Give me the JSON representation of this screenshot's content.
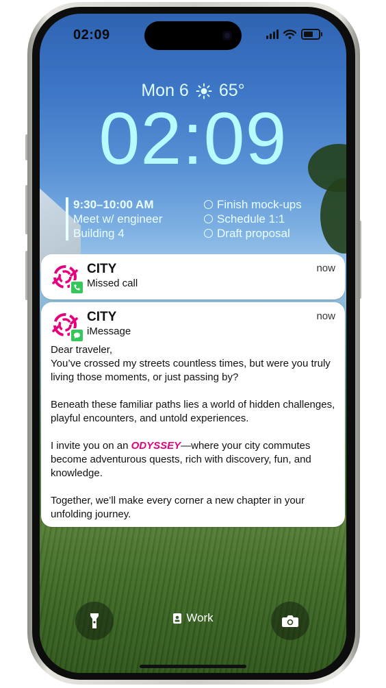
{
  "status_bar": {
    "time": "02:09",
    "icons": [
      "signal-icon",
      "wifi-icon",
      "battery-icon"
    ]
  },
  "lock_screen": {
    "date": "Mon 6",
    "weather_icon": "sun-icon",
    "temperature": "65°",
    "clock": "02:09"
  },
  "calendar_widget": {
    "time": "9:30–10:00 AM",
    "title": "Meet w/ engineer",
    "location": "Building 4"
  },
  "reminders_widget": {
    "items": [
      "Finish mock-ups",
      "Schedule 1:1",
      "Draft proposal"
    ]
  },
  "notifications": [
    {
      "app": "CITY",
      "subtitle": "Missed call",
      "time": "now",
      "badge_icon": "phone-icon"
    },
    {
      "app": "CITY",
      "subtitle": "iMessage",
      "time": "now",
      "badge_icon": "message-icon",
      "body": {
        "greeting": "Dear traveler,",
        "p1": "You’ve crossed my streets countless times, but were you truly living those moments, or just passing by?",
        "p2": "Beneath these familiar paths lies a world of hidden challenges, playful encounters, and untold experiences.",
        "p3_before": "I invite you on an ",
        "p3_highlight": "ODYSSEY",
        "p3_after": "—where your city commutes become adventurous quests, rich with discovery, fun, and knowledge.",
        "p4": "Together, we’ll make every corner a new chapter in your unfolding journey."
      }
    }
  ],
  "bottom_controls": {
    "left_icon": "flashlight-icon",
    "focus_label": "Work",
    "focus_icon": "badge-icon",
    "right_icon": "camera-icon"
  },
  "colors": {
    "brand_pink": "#e6007e",
    "clock": "#b6fbff",
    "badge_green": "#34c759"
  }
}
